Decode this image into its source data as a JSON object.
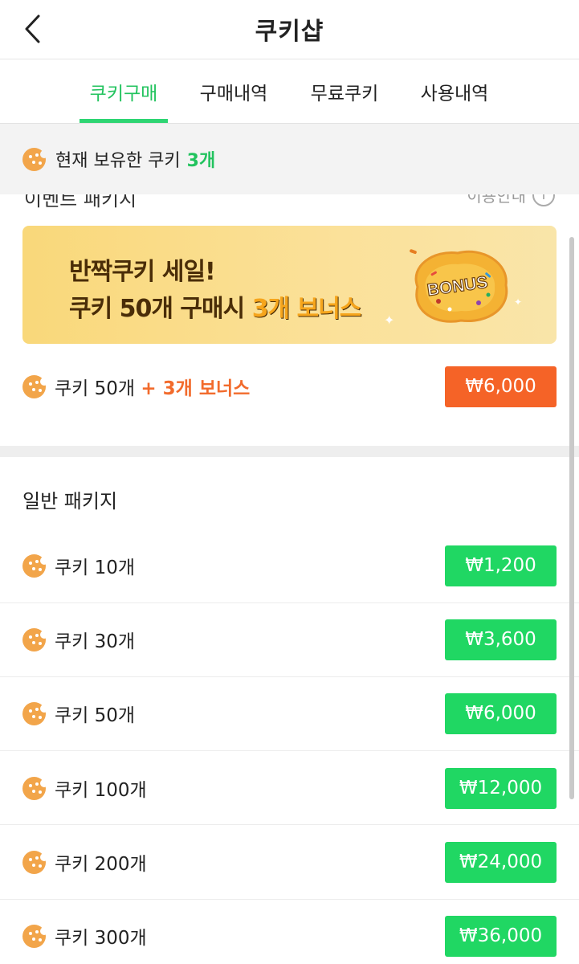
{
  "header": {
    "back_icon": "chevron-left-icon",
    "title": "쿠키샵"
  },
  "tabs": [
    {
      "label": "쿠키구매",
      "active": true
    },
    {
      "label": "구매내역",
      "active": false
    },
    {
      "label": "무료쿠키",
      "active": false
    },
    {
      "label": "사용내역",
      "active": false
    }
  ],
  "balance": {
    "icon": "cookie-icon",
    "label": "현재 보유한 쿠키",
    "count": "3개"
  },
  "event": {
    "section_title": "이벤트 패키지",
    "info_label": "이용안내",
    "info_icon": "info-icon",
    "banner": {
      "line1": "반짝쿠키 세일!",
      "line2_prefix": "쿠키 50개 구매시 ",
      "line2_highlight": "3개 보너스",
      "badge": "BONUS"
    },
    "package": {
      "label": "쿠키 50개",
      "bonus": "+ 3개 보너스",
      "price": "₩6,000"
    }
  },
  "general": {
    "section_title": "일반 패키지",
    "packages": [
      {
        "label": "쿠키 10개",
        "price": "₩1,200"
      },
      {
        "label": "쿠키 30개",
        "price": "₩3,600"
      },
      {
        "label": "쿠키 50개",
        "price": "₩6,000"
      },
      {
        "label": "쿠키 100개",
        "price": "₩12,000"
      },
      {
        "label": "쿠키 200개",
        "price": "₩24,000"
      },
      {
        "label": "쿠키 300개",
        "price": "₩36,000"
      }
    ]
  },
  "colors": {
    "accent_green": "#22c35e",
    "price_green": "#20d763",
    "price_orange": "#f56327",
    "bonus_text": "#f26b2c",
    "cookie": "#f2a54a"
  }
}
